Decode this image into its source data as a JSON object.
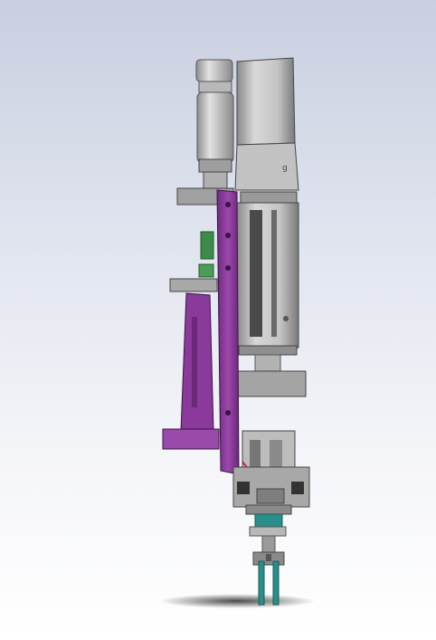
{
  "scene": {
    "background_top": "#c9cfe0",
    "background_bottom": "#ffffff",
    "colors": {
      "purple_frame": "#8a3a9a",
      "purple_dark": "#5a1f66",
      "motor_grey": "#c8c8c8",
      "motor_dark": "#6e6e6e",
      "plate_grey": "#9a9a9a",
      "green_accent": "#3e8a4a",
      "teal_fingers": "#2a8f8a",
      "red_cable": "#c0283a"
    },
    "components": [
      "servo-motor",
      "pneumatic-cylinder",
      "linear-module",
      "mounting-bracket",
      "gripper-fingers"
    ]
  }
}
